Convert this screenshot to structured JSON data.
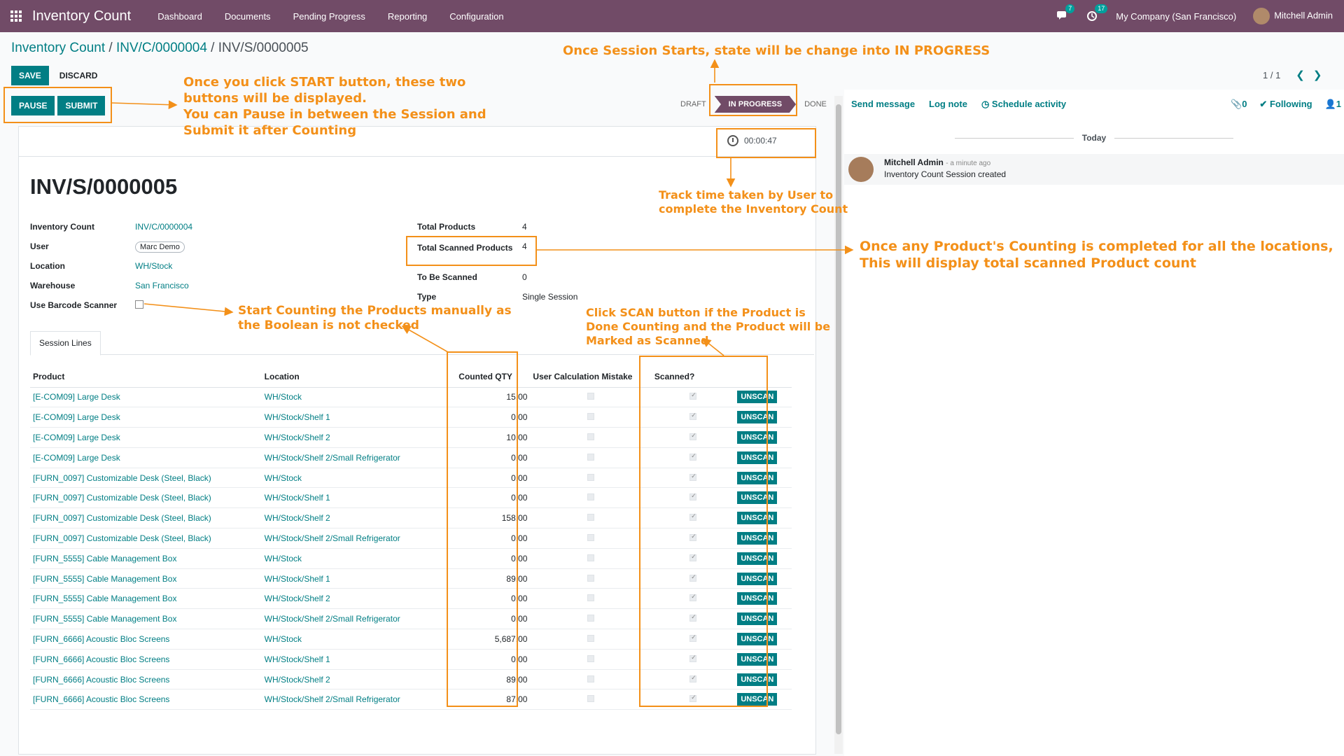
{
  "topbar": {
    "app_title": "Inventory Count",
    "menu": [
      "Dashboard",
      "Documents",
      "Pending Progress",
      "Reporting",
      "Configuration"
    ],
    "messages_count": "7",
    "activities_count": "17",
    "company": "My Company (San Francisco)",
    "user": "Mitchell Admin"
  },
  "breadcrumb": {
    "part1": "Inventory Count",
    "sep": " / ",
    "part2": "INV/C/0000004",
    "part3": "INV/S/0000005"
  },
  "buttons": {
    "save": "SAVE",
    "discard": "DISCARD",
    "pause": "PAUSE",
    "submit": "SUBMIT",
    "unscan": "UNSCAN"
  },
  "pager": {
    "value": "1 / 1"
  },
  "status": {
    "draft": "DRAFT",
    "in_progress": "IN PROGRESS",
    "done": "DONE"
  },
  "timer": "00:00:47",
  "record": {
    "title": "INV/S/0000005",
    "left_fields": [
      {
        "label": "Inventory Count",
        "value": "INV/C/0000004"
      },
      {
        "label": "User",
        "value": "Marc Demo"
      },
      {
        "label": "Location",
        "value": "WH/Stock"
      },
      {
        "label": "Warehouse",
        "value": "San Francisco"
      },
      {
        "label": "Use Barcode Scanner",
        "value": ""
      }
    ],
    "right_fields": [
      {
        "label": "Total Products",
        "value": "4"
      },
      {
        "label": "Total Scanned Products",
        "value": "4"
      },
      {
        "label": "To Be Scanned",
        "value": "0"
      },
      {
        "label": "Type",
        "value": "Single Session"
      }
    ]
  },
  "tab": "Session Lines",
  "table": {
    "headers": [
      "Product",
      "Location",
      "Counted QTY",
      "User Calculation Mistake",
      "Scanned?"
    ],
    "rows": [
      {
        "product": "[E-COM09] Large Desk",
        "location": "WH/Stock",
        "qty": "15.00"
      },
      {
        "product": "[E-COM09] Large Desk",
        "location": "WH/Stock/Shelf 1",
        "qty": "0.00"
      },
      {
        "product": "[E-COM09] Large Desk",
        "location": "WH/Stock/Shelf 2",
        "qty": "10.00"
      },
      {
        "product": "[E-COM09] Large Desk",
        "location": "WH/Stock/Shelf 2/Small Refrigerator",
        "qty": "0.00"
      },
      {
        "product": "[FURN_0097] Customizable Desk (Steel, Black)",
        "location": "WH/Stock",
        "qty": "0.00"
      },
      {
        "product": "[FURN_0097] Customizable Desk (Steel, Black)",
        "location": "WH/Stock/Shelf 1",
        "qty": "0.00"
      },
      {
        "product": "[FURN_0097] Customizable Desk (Steel, Black)",
        "location": "WH/Stock/Shelf 2",
        "qty": "158.00"
      },
      {
        "product": "[FURN_0097] Customizable Desk (Steel, Black)",
        "location": "WH/Stock/Shelf 2/Small Refrigerator",
        "qty": "0.00"
      },
      {
        "product": "[FURN_5555] Cable Management Box",
        "location": "WH/Stock",
        "qty": "0.00"
      },
      {
        "product": "[FURN_5555] Cable Management Box",
        "location": "WH/Stock/Shelf 1",
        "qty": "89.00"
      },
      {
        "product": "[FURN_5555] Cable Management Box",
        "location": "WH/Stock/Shelf 2",
        "qty": "0.00"
      },
      {
        "product": "[FURN_5555] Cable Management Box",
        "location": "WH/Stock/Shelf 2/Small Refrigerator",
        "qty": "0.00"
      },
      {
        "product": "[FURN_6666] Acoustic Bloc Screens",
        "location": "WH/Stock",
        "qty": "5,687.00"
      },
      {
        "product": "[FURN_6666] Acoustic Bloc Screens",
        "location": "WH/Stock/Shelf 1",
        "qty": "0.00"
      },
      {
        "product": "[FURN_6666] Acoustic Bloc Screens",
        "location": "WH/Stock/Shelf 2",
        "qty": "89.00"
      },
      {
        "product": "[FURN_6666] Acoustic Bloc Screens",
        "location": "WH/Stock/Shelf 2/Small Refrigerator",
        "qty": "87.00"
      }
    ]
  },
  "chatter": {
    "send_message": "Send message",
    "log_note": "Log note",
    "schedule_activity": "Schedule activity",
    "attachments": "0",
    "following": "Following",
    "followers": "1",
    "today": "Today",
    "message": {
      "author": "Mitchell Admin",
      "ago": "- a minute ago",
      "body": "Inventory Count Session created"
    }
  },
  "annotations": {
    "state": "Once Session Starts, state will be change into IN PROGRESS",
    "buttons_1": "Once you click START button, these two",
    "buttons_2": "buttons will be displayed.",
    "buttons_3": "You can Pause in between the Session and",
    "buttons_4": "Submit it after Counting",
    "timer_1": "Track time taken by User to",
    "timer_2": "complete the Inventory Count",
    "scanned_1": "Once any Product's Counting is completed for all the locations,",
    "scanned_2": "This will display total scanned Product count",
    "manual_1": "Start Counting the Products manually as",
    "manual_2": "the Boolean is not checked",
    "scan_1": "Click SCAN button if the Product is",
    "scan_2": "Done Counting and the Product will be",
    "scan_3": "Marked as Scanned"
  },
  "colors": {
    "brand": "#714b67",
    "primary": "#017e84",
    "annotation": "#f39019"
  }
}
